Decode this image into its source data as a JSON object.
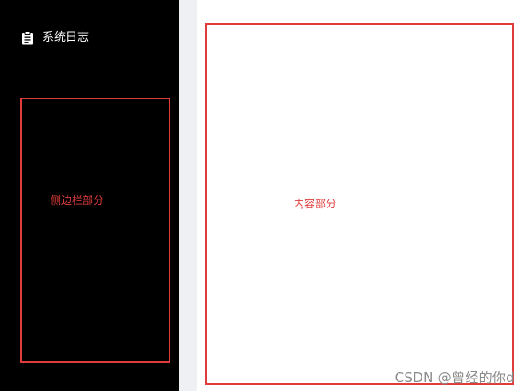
{
  "sidebar": {
    "nav_items": [
      {
        "label": "系统日志",
        "icon": "clipboard-icon"
      }
    ]
  },
  "annotations": {
    "sidebar_label": "侧边栏部分",
    "content_label": "内容部分"
  },
  "watermark": {
    "text": "CSDN @曾经的你d"
  },
  "colors": {
    "sidebar_bg": "#000000",
    "gutter_bg": "#eef0f4",
    "content_bg": "#ffffff",
    "annotation_red": "#e03c3c",
    "nav_text": "#ffffff"
  }
}
